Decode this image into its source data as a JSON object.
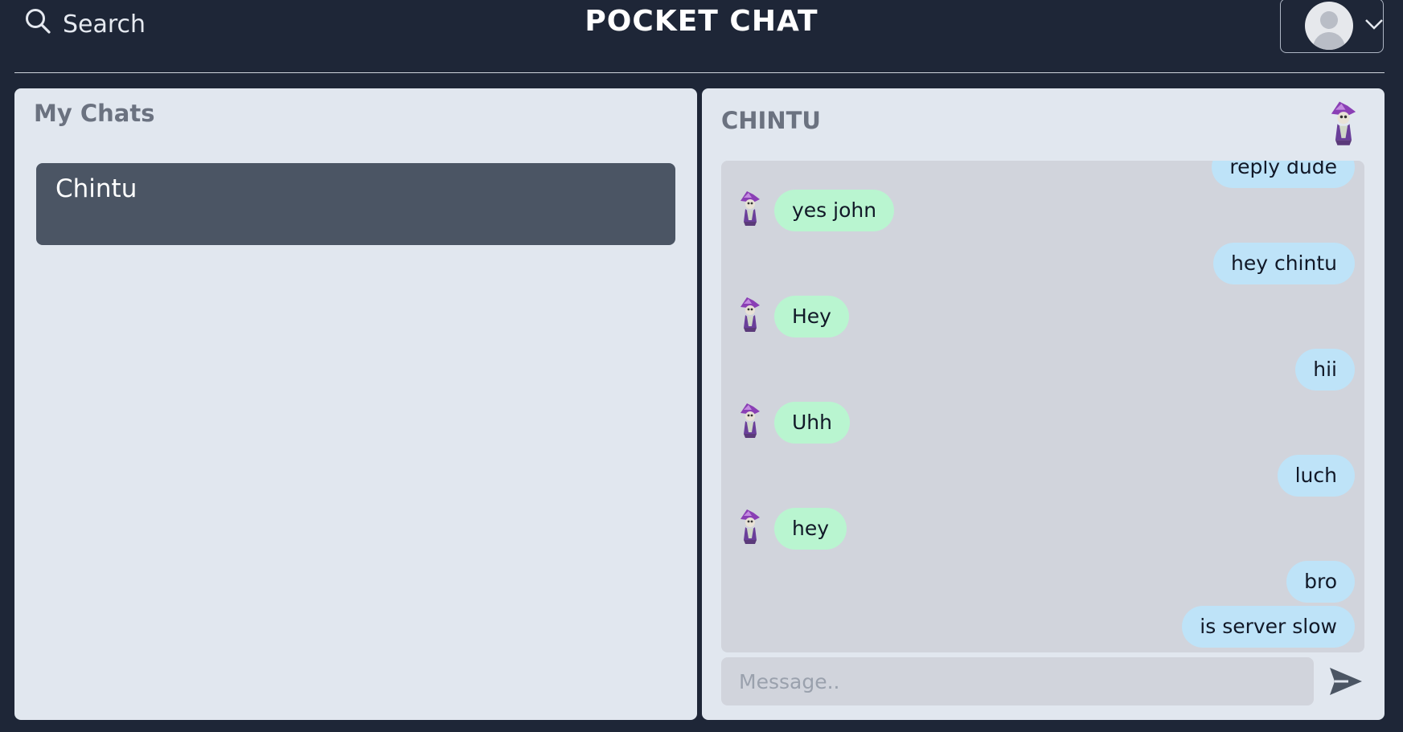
{
  "header": {
    "search_label": "Search",
    "brand": "POCKET CHAT",
    "search_icon": "search-icon",
    "profile_icon": "user-avatar-icon",
    "menu_icon": "chevron-down-icon"
  },
  "sidebar": {
    "title": "My Chats",
    "chats": [
      {
        "name": "Chintu",
        "selected": true
      }
    ]
  },
  "chat": {
    "contact_name": "CHINTU",
    "messages": [
      {
        "from": "me",
        "text": "reply dude"
      },
      {
        "from": "them",
        "text": "yes john"
      },
      {
        "from": "me",
        "text": "hey chintu"
      },
      {
        "from": "them",
        "text": "Hey"
      },
      {
        "from": "me",
        "text": "hii"
      },
      {
        "from": "them",
        "text": "Uhh"
      },
      {
        "from": "me",
        "text": "luch"
      },
      {
        "from": "them",
        "text": "hey"
      },
      {
        "from": "me",
        "text": "bro"
      },
      {
        "from": "me",
        "text": "is server slow"
      }
    ],
    "composer": {
      "value": "",
      "placeholder": "Message.."
    },
    "send_icon": "send-icon"
  },
  "colors": {
    "app_background": "#1e2637",
    "panel_background": "#e1e7ef",
    "selected_chat": "#4b5564",
    "incoming_bubble": "#b9f5d0",
    "outgoing_bubble": "#bee3f8"
  }
}
